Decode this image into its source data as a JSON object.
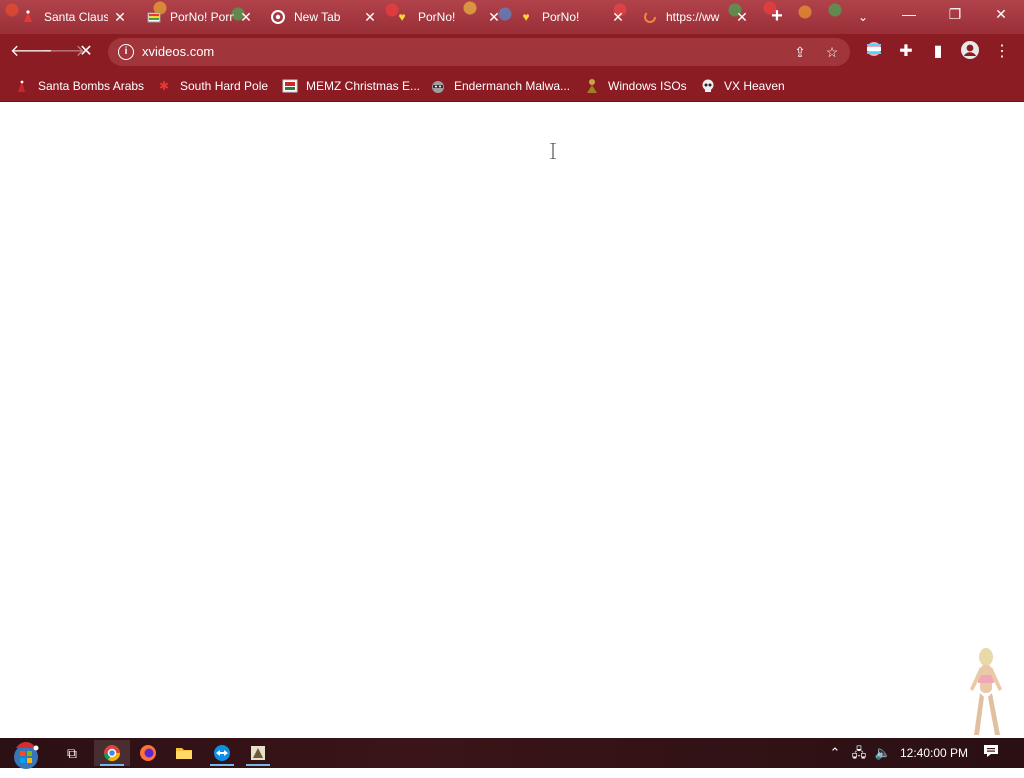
{
  "browser": {
    "tabs": [
      {
        "title": "Santa Claus",
        "favicon": "santa-icon"
      },
      {
        "title": "PorNo! Porn",
        "favicon": "rainbow-icon"
      },
      {
        "title": "New Tab",
        "favicon": "chrome-icon"
      },
      {
        "title": "PorNo!",
        "favicon": "heart-icon"
      },
      {
        "title": "PorNo!",
        "favicon": "heart-icon"
      },
      {
        "title": "https://ww",
        "favicon": "loading-icon"
      }
    ],
    "active_tab_index": 5,
    "address": "xvideos.com",
    "bookmarks": [
      {
        "label": "Santa Bombs Arabs",
        "icon": "santa-icon"
      },
      {
        "label": "South Hard Pole",
        "icon": "snowflake-icon"
      },
      {
        "label": "MEMZ Christmas E...",
        "icon": "image-icon"
      },
      {
        "label": "Endermanch Malwa...",
        "icon": "raccoon-icon"
      },
      {
        "label": "Windows ISOs",
        "icon": "figure-icon"
      },
      {
        "label": "VX Heaven",
        "icon": "skull-icon"
      }
    ],
    "accent_color": "#8c1c24"
  },
  "taskbar": {
    "clock": "12:40:00 PM",
    "apps": [
      "start-orb",
      "task-view",
      "chrome",
      "firefox",
      "file-explorer",
      "teamviewer",
      "app"
    ]
  }
}
